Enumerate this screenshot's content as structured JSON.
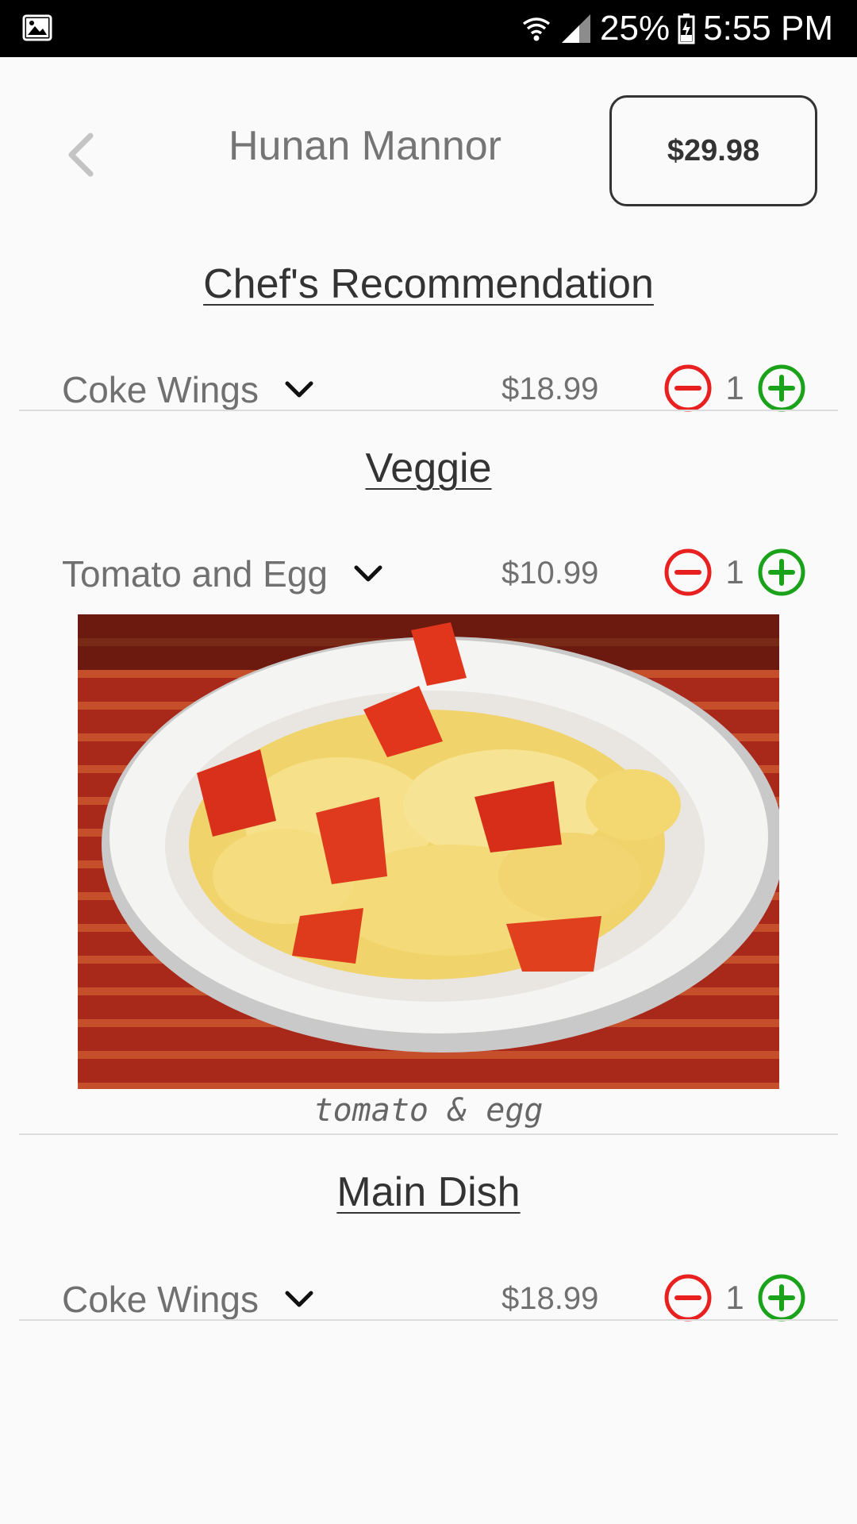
{
  "status_bar": {
    "battery": "25%",
    "time": "5:55 PM"
  },
  "header": {
    "title": "Hunan Mannor",
    "cart_total": "$29.98"
  },
  "sections": [
    {
      "title": "Chef's Recommendation",
      "items": [
        {
          "name": "Coke Wings",
          "price": "$18.99",
          "quantity": "1"
        }
      ]
    },
    {
      "title": "Veggie",
      "items": [
        {
          "name": "Tomato and Egg",
          "price": "$10.99",
          "quantity": "1",
          "photo_caption": "tomato & egg"
        }
      ]
    },
    {
      "title": "Main Dish",
      "items": [
        {
          "name": "Coke Wings",
          "price": "$18.99",
          "quantity": "1"
        }
      ]
    }
  ],
  "colors": {
    "decrement": "#e82020",
    "increment": "#1aa31a",
    "text_gray": "#707070",
    "status_bar_bg": "#000000"
  },
  "icons": [
    "gallery-icon",
    "wifi-icon",
    "signal-icon",
    "battery-icon",
    "back-chevron-icon",
    "chevron-down-icon",
    "minus-circle-icon",
    "plus-circle-icon"
  ]
}
